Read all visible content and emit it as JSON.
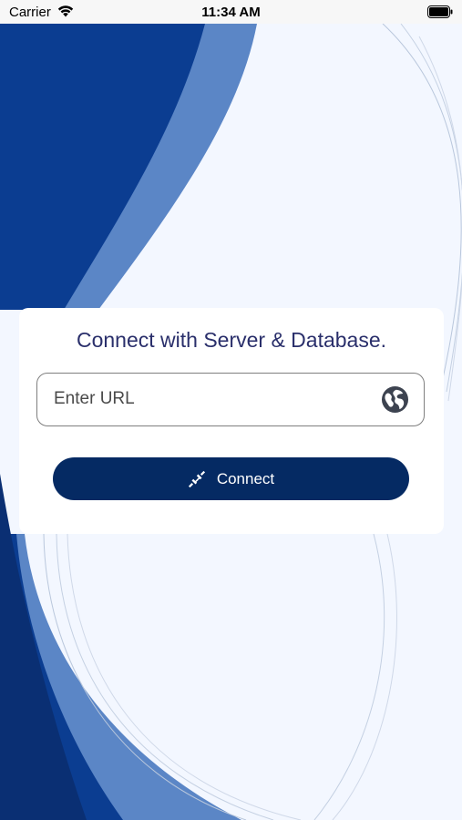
{
  "status_bar": {
    "carrier": "Carrier",
    "time": "11:34 AM",
    "wifi_icon": "wifi-icon",
    "battery_icon": "battery-icon"
  },
  "card": {
    "title": "Connect with Server & Database.",
    "url_field": {
      "value": "",
      "placeholder": "Enter URL",
      "icon": "globe-icon"
    },
    "connect_button": {
      "label": "Connect",
      "icon": "plug-icon"
    }
  },
  "colors": {
    "background": "#f3f7ff",
    "dark_blue": "#0a3a8f",
    "mid_blue": "#5b86c6",
    "navy": "#052a63",
    "title_text": "#2a2f6b"
  }
}
